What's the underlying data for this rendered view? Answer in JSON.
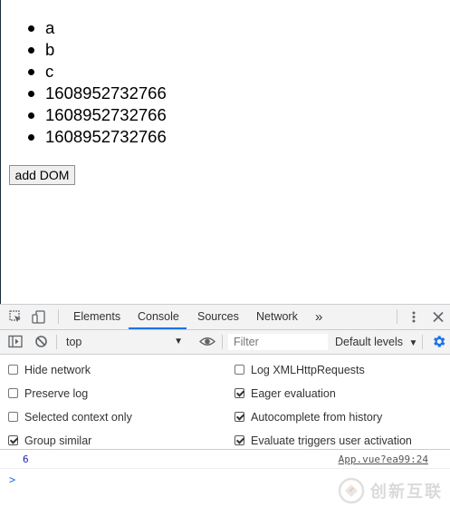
{
  "list": {
    "items": [
      "a",
      "b",
      "c",
      "1608952732766",
      "1608952732766",
      "1608952732766"
    ]
  },
  "add_button_label": "add DOM",
  "devtools": {
    "tabs": {
      "elements": "Elements",
      "console": "Console",
      "sources": "Sources",
      "network": "Network",
      "more": "»"
    },
    "active_tab": "Console",
    "context": "top",
    "filter_placeholder": "Filter",
    "levels_label": "Default levels",
    "accent_color": "#1a73e8",
    "settings": {
      "hide_network": {
        "label": "Hide network",
        "checked": false
      },
      "log_xhr": {
        "label": "Log XMLHttpRequests",
        "checked": false
      },
      "preserve_log": {
        "label": "Preserve log",
        "checked": false
      },
      "eager_eval": {
        "label": "Eager evaluation",
        "checked": true
      },
      "selected_context": {
        "label": "Selected context only",
        "checked": false
      },
      "autocomplete": {
        "label": "Autocomplete from history",
        "checked": true
      },
      "group_similar": {
        "label": "Group similar",
        "checked": true
      },
      "evaluate_triggers": {
        "label": "Evaluate triggers user activation",
        "checked": true
      }
    },
    "log": {
      "value": "6",
      "source": "App.vue?ea99:24"
    },
    "prompt_symbol": ">"
  },
  "watermark": {
    "text": "创新互联"
  }
}
